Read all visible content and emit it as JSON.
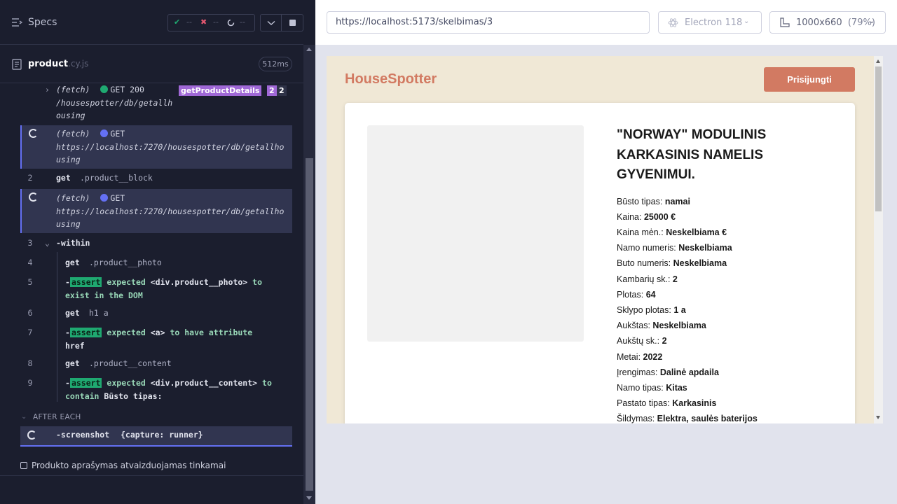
{
  "header": {
    "specs_label": "Specs",
    "stats": {
      "pass_icon": "✔",
      "pass_count": "--",
      "fail_icon": "✖",
      "fail_count": "--",
      "pending_count": "--"
    }
  },
  "spec_file": {
    "name": "product",
    "ext": ".cy.js",
    "duration": "512ms"
  },
  "commands": {
    "fetch1": {
      "type": "(fetch)",
      "method_status": "GET 200",
      "url": "/housespotter/db/getallhousing",
      "url_1": "/housespotter/db/getallh",
      "url_2": "ousing",
      "alias": "getProductDetails",
      "alias_count": "2",
      "count": "2"
    },
    "fetch2": {
      "type": "(fetch)",
      "method": "GET",
      "url_1": "https://localhost:7270/housespotter/db/getallho",
      "url_2": "using"
    },
    "cmd2": {
      "num": "2",
      "name": "get",
      "selector": ".product__block"
    },
    "fetch3": {
      "type": "(fetch)",
      "method": "GET",
      "url_1": "https://localhost:7270/housespotter/db/getallho",
      "url_2": "using"
    },
    "cmd3": {
      "num": "3",
      "name": "-within"
    },
    "cmd4": {
      "num": "4",
      "name": "get",
      "selector": ".product__photo"
    },
    "cmd5": {
      "num": "5",
      "prefix": "-",
      "tag": "assert",
      "msg_1": "expected",
      "subject": "<div.product__photo>",
      "msg_2": "to",
      "msg_3": "exist in the DOM"
    },
    "cmd6": {
      "num": "6",
      "name": "get",
      "selector": "h1 a"
    },
    "cmd7": {
      "num": "7",
      "prefix": "-",
      "tag": "assert",
      "msg_1": "expected",
      "subject": "<a>",
      "msg_2": "to have attribute",
      "value": "href"
    },
    "cmd8": {
      "num": "8",
      "name": "get",
      "selector": ".product__content"
    },
    "cmd9": {
      "num": "9",
      "prefix": "-",
      "tag": "assert",
      "msg_1": "expected",
      "subject": "<div.product__content>",
      "msg_2": "to",
      "msg_3": "contain",
      "value": "Būsto tipas:"
    }
  },
  "after_each": {
    "label": "AFTER EACH",
    "screenshot": {
      "name": "-screenshot",
      "args": "{capture: runner}"
    }
  },
  "test": {
    "title": "Produkto aprašymas atvaizduojamas tinkamai"
  },
  "browser_bar": {
    "url": "https://localhost:5173/skelbimas/3",
    "browser": "Electron 118",
    "viewport": "1000x660",
    "zoom": "(79%)"
  },
  "site": {
    "logo": "HouseSpotter",
    "login_button": "Prisijungti",
    "product_title": "\"NORWAY\" MODULINIS KARKASINIS NAMELIS GYVENIMUI.",
    "fields": [
      {
        "label": "Būsto tipas:",
        "value": "namai"
      },
      {
        "label": "Kaina:",
        "value": "25000 €"
      },
      {
        "label": "Kaina mėn.:",
        "value": "Neskelbiama €"
      },
      {
        "label": "Namo numeris:",
        "value": "Neskelbiama"
      },
      {
        "label": "Buto numeris:",
        "value": "Neskelbiama"
      },
      {
        "label": "Kambarių sk.:",
        "value": "2"
      },
      {
        "label": "Plotas:",
        "value": "64"
      },
      {
        "label": "Sklypo plotas:",
        "value": "1 a"
      },
      {
        "label": "Aukštas:",
        "value": "Neskelbiama"
      },
      {
        "label": "Aukštų sk.:",
        "value": "2"
      },
      {
        "label": "Metai:",
        "value": "2022"
      },
      {
        "label": "Įrengimas:",
        "value": "Dalinė apdaila"
      },
      {
        "label": "Namo tipas:",
        "value": "Kitas"
      },
      {
        "label": "Pastato tipas:",
        "value": "Karkasinis"
      },
      {
        "label": "Šildymas:",
        "value": "Elektra, saulės baterijos"
      }
    ]
  },
  "colors": {
    "accent": "#d27a62",
    "page_bg": "#f0e8d6",
    "runner_bg": "#1b1e2e",
    "pending": "#6470f3",
    "pass": "#1fa971",
    "fail": "#e45770"
  }
}
